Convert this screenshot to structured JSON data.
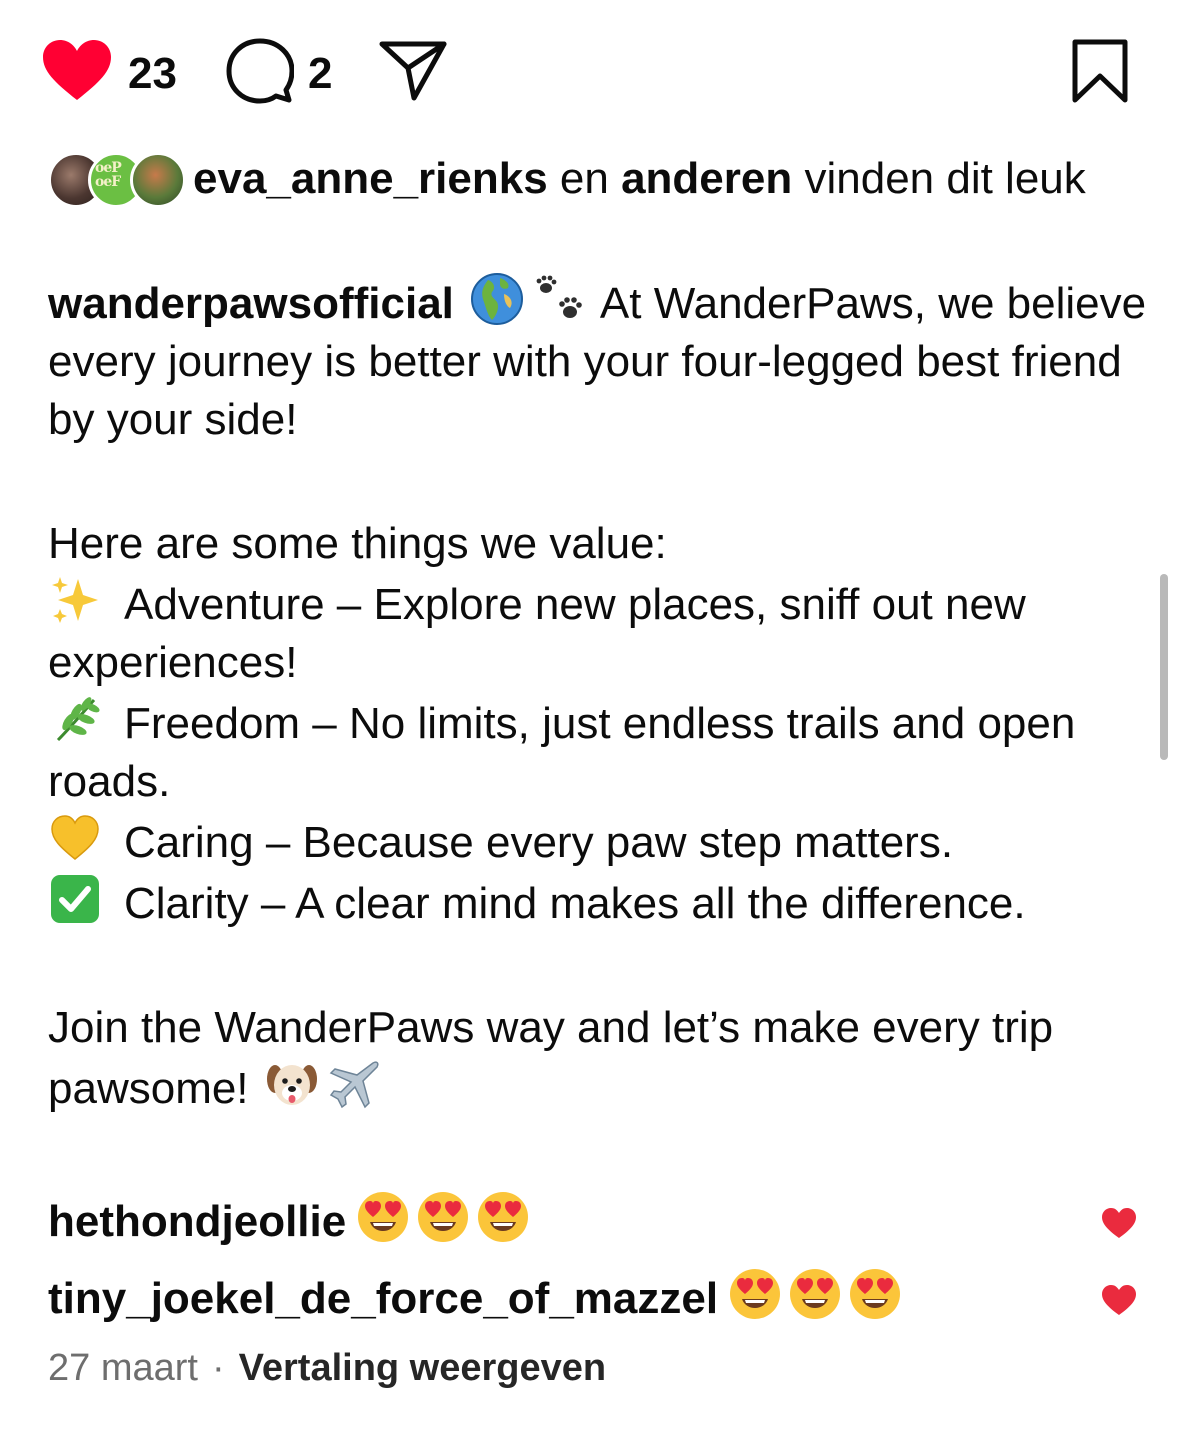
{
  "actions": {
    "like_count": "23",
    "comment_count": "2",
    "like_color": "#ff0033"
  },
  "likes_summary": {
    "avatar_text": "oeP oeF",
    "first_user": "eva_anne_rienks",
    "connector": " en ",
    "others": "anderen",
    "suffix": " vinden dit leuk"
  },
  "caption": {
    "username": "wanderpawsofficial",
    "intro_emojis": [
      "globe-europe-africa-emoji",
      "paw-prints-emoji"
    ],
    "intro_text": " At WanderPaws, we believe every journey is better with your four-legged best friend by your side!",
    "values_heading": "Here are some things we value:",
    "values": [
      {
        "icon": "sparkles-emoji",
        "text": "Adventure – Explore new places, sniff out new experiences!"
      },
      {
        "icon": "herb-emoji",
        "text": "Freedom – No limits, just endless trails and open roads."
      },
      {
        "icon": "yellow-heart-emoji",
        "text": "Caring – Because every paw step matters."
      },
      {
        "icon": "check-mark-button-emoji",
        "text": "Clarity – A clear mind makes all the difference."
      }
    ],
    "outro_text": "Join the WanderPaws way and let’s make every trip pawsome! ",
    "outro_emojis": [
      "dog-face-emoji",
      "airplane-emoji"
    ]
  },
  "comments": [
    {
      "user": "hethondjeollie",
      "emojis": [
        "heart-eyes-emoji",
        "heart-eyes-emoji",
        "heart-eyes-emoji"
      ],
      "liked": true
    },
    {
      "user": "tiny_joekel_de_force_of_mazzel",
      "emojis": [
        "heart-eyes-emoji",
        "heart-eyes-emoji",
        "heart-eyes-emoji"
      ],
      "liked": true
    }
  ],
  "footer": {
    "date": "27 maart",
    "separator": "·",
    "translate_label": "Vertaling weergeven"
  }
}
